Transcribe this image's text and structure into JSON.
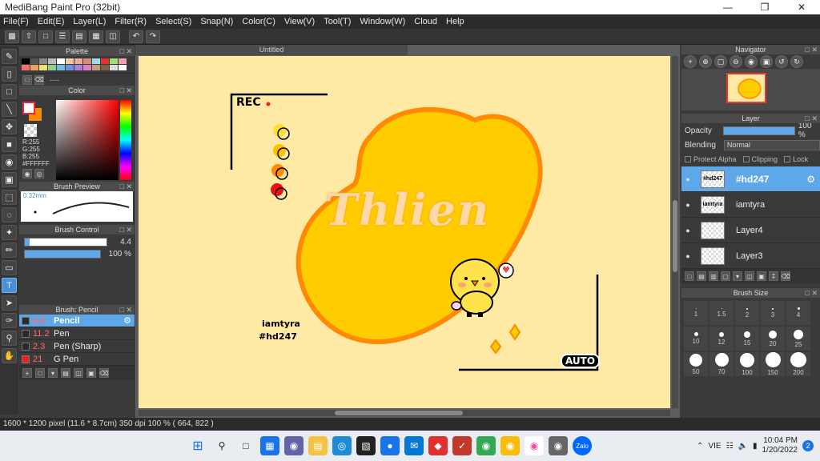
{
  "window": {
    "title": "MediBang Paint Pro (32bit)",
    "min": "—",
    "max": "❐",
    "close": "✕"
  },
  "menu": [
    "File(F)",
    "Edit(E)",
    "Layer(L)",
    "Filter(R)",
    "Select(S)",
    "Snap(N)",
    "Color(C)",
    "View(V)",
    "Tool(T)",
    "Window(W)",
    "Cloud",
    "Help"
  ],
  "panels": {
    "palette": "Palette",
    "palette_name": "----",
    "color": "Color",
    "brush_preview": "Brush Preview",
    "brush_control": "Brush Control",
    "brush_list": "Brush: Pencil",
    "navigator": "Navigator",
    "layer": "Layer",
    "brush_size": "Brush Size"
  },
  "color": {
    "r": "R:255",
    "g": "G:255",
    "b": "B:255",
    "hex": "#FFFFFF",
    "fg": "#ffffff",
    "bg": "#ff8800"
  },
  "brush_preview": {
    "size": "0.32mm"
  },
  "brush_control": {
    "size": "4.4",
    "opacity": "100 %",
    "opacity_value": 1.0,
    "size_value": 0.96
  },
  "brushes": [
    {
      "size": "4.4",
      "name": "Pencil",
      "color": "#2b2b2b"
    },
    {
      "size": "11.2",
      "name": "Pen",
      "color": "#2b2b2b"
    },
    {
      "size": "2.3",
      "name": "Pen (Sharp)",
      "color": "#2b2b2b"
    },
    {
      "size": "21",
      "name": "G Pen",
      "color": "#e22"
    }
  ],
  "document": {
    "tab": "Untitled"
  },
  "art": {
    "rec": "REC",
    "author": "iamtyra",
    "code": "#hd247",
    "auto": "AUTO",
    "script": "Thlien"
  },
  "layer_panel": {
    "opacity_label": "Opacity",
    "opacity_value": "100 %",
    "blending_label": "Blending",
    "blending_value": "Normal",
    "protect_alpha": "Protect Alpha",
    "clipping": "Clipping",
    "lock": "Lock",
    "layers": [
      {
        "name": "#hd247",
        "thumb": "#hd247"
      },
      {
        "name": "iamtyra",
        "thumb": "iamtyra"
      },
      {
        "name": "Layer4",
        "thumb": ""
      },
      {
        "name": "Layer3",
        "thumb": ""
      }
    ]
  },
  "brush_sizes": [
    "1",
    "1.5",
    "2",
    "3",
    "4",
    "10",
    "12",
    "15",
    "20",
    "25",
    "50",
    "70",
    "100",
    "150",
    "200"
  ],
  "status": {
    "text": "1600 * 1200 pixel   (11.6 * 8.7cm)   350 dpi   100 %   ( 664, 822 )"
  },
  "taskbar": {
    "lang": "VIE",
    "time": "10:04 PM",
    "date": "1/20/2022",
    "badge": "2",
    "zalo": "Zalo"
  }
}
